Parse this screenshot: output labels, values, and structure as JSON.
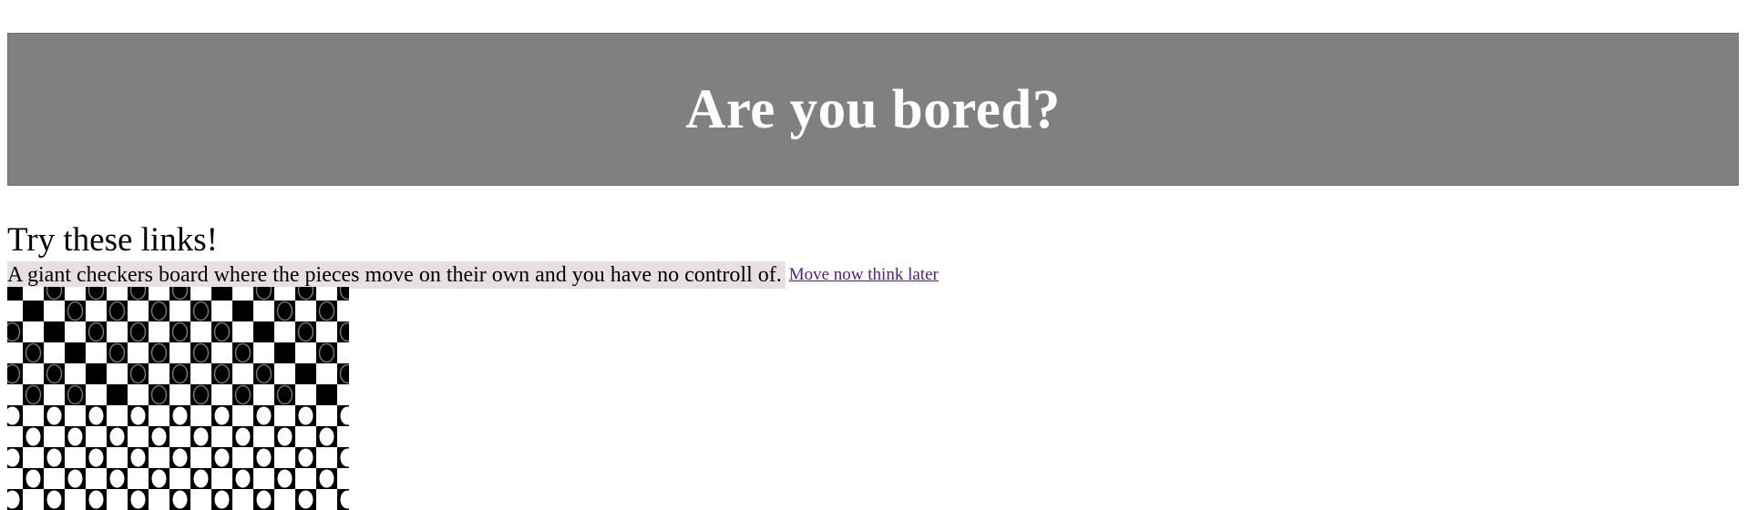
{
  "banner": {
    "title": "Are you bored?",
    "background": "#808080",
    "text_color": "#ffffff"
  },
  "content": {
    "subtitle": "Try these links!",
    "description": "A giant checkers board where the pieces move on their own and you have no controll of.",
    "link_label": "Move now think later",
    "link_color": "#551a8b"
  },
  "checkerboard": {
    "image_icon": "checkers-board-image",
    "dark_color": "#000000",
    "light_color": "#ffffff",
    "piece_outline_color": "#777777"
  }
}
